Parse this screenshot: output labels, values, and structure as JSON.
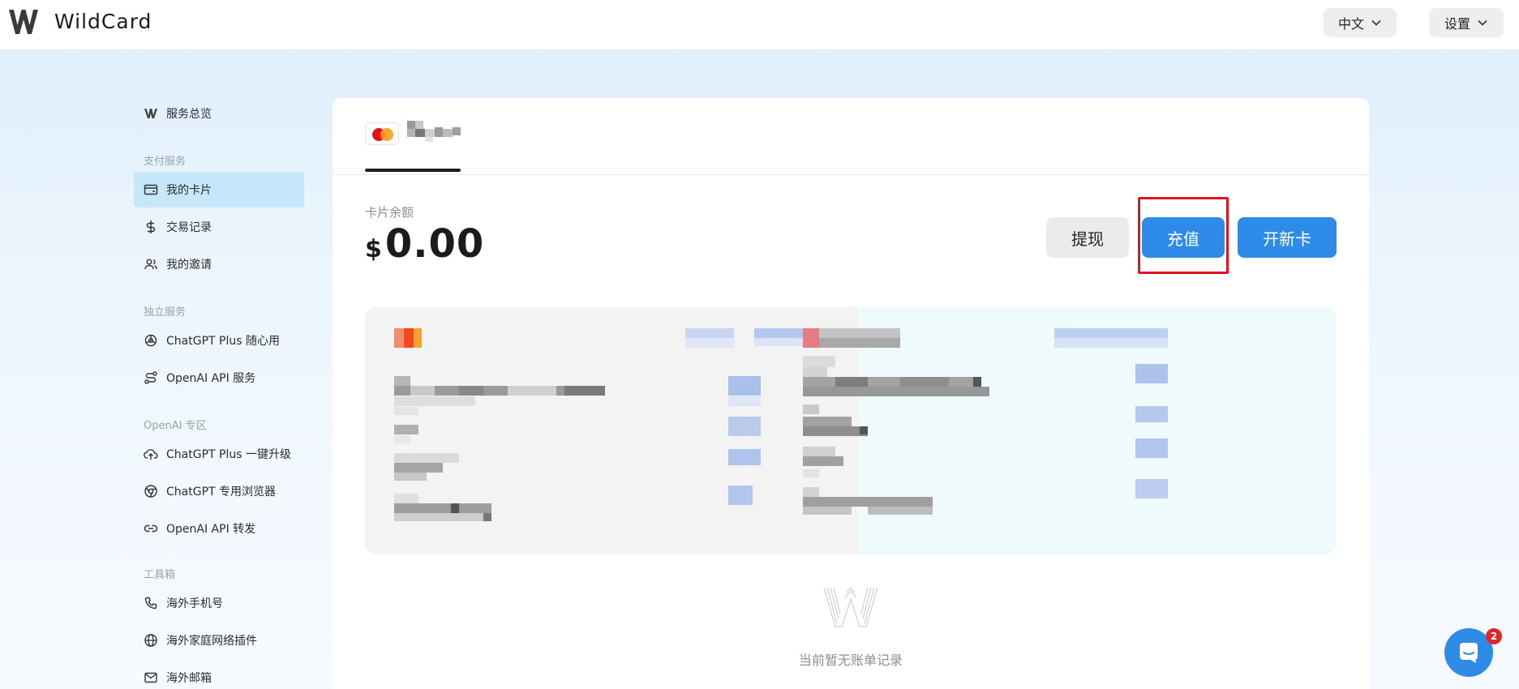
{
  "header": {
    "app_title": "WildCard",
    "language_label": "中文",
    "settings_label": "设置"
  },
  "sidebar": {
    "overview": "服务总览",
    "sections": {
      "payment": "支付服务",
      "independent": "独立服务",
      "openai": "OpenAI 专区",
      "toolbox": "工具箱"
    },
    "items": {
      "my_cards": "我的卡片",
      "transactions": "交易记录",
      "invitations": "我的邀请",
      "chatgpt_plus_anytime": "ChatGPT Plus 随心用",
      "openai_api_service": "OpenAI API 服务",
      "chatgpt_plus_upgrade": "ChatGPT Plus 一键升级",
      "chatgpt_browser": "ChatGPT 专用浏览器",
      "openai_api_forward": "OpenAI API 转发",
      "overseas_phone": "海外手机号",
      "home_network_plugin": "海外家庭网络插件",
      "overseas_email": "海外邮箱"
    }
  },
  "main": {
    "balance_label": "卡片余额",
    "balance_currency": "$",
    "balance_amount": "0.00",
    "buttons": {
      "withdraw": "提现",
      "recharge": "充值",
      "new_card": "开新卡"
    },
    "empty_state": "当前暂无账单记录"
  },
  "chat": {
    "badge_count": "2"
  },
  "colors": {
    "accent": "#2f8be8",
    "active_nav": "#c6e6fa",
    "highlight": "#e0141d"
  }
}
